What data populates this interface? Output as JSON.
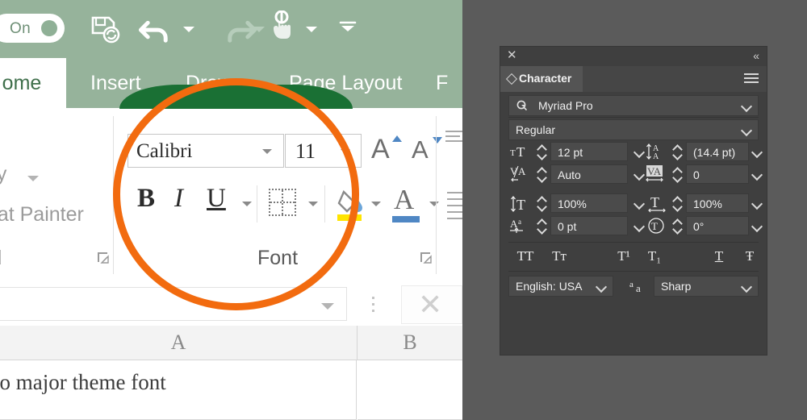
{
  "excel": {
    "quick_access": {
      "autosave_label": "On",
      "icons": [
        "save-sync-icon",
        "undo-icon",
        "undo-dropdown-icon",
        "redo-icon",
        "redo-dropdown-icon",
        "touch-mode-icon",
        "touch-mode-dropdown-icon",
        "customize-toolbar-icon"
      ]
    },
    "tabs": [
      {
        "id": "home",
        "label": "ome",
        "active": true
      },
      {
        "id": "insert",
        "label": "Insert",
        "active": false
      },
      {
        "id": "draw",
        "label": "Draw",
        "active": false
      },
      {
        "id": "pagelayout",
        "label": "Page Layout",
        "active": false
      },
      {
        "id": "formulas",
        "label": "F",
        "active": false
      }
    ],
    "clipboard_group": {
      "copy_label": "py",
      "format_painter_label": "mat Painter",
      "group_label": "rd"
    },
    "font_group": {
      "font_name": "Calibri",
      "font_size": "11",
      "grow_font_label": "A",
      "shrink_font_label": "A",
      "bold_label": "B",
      "italic_label": "I",
      "underline_label": "U",
      "group_label": "Font",
      "highlight_color": "#ffe400",
      "font_color": "#4f87c4"
    },
    "formula_bar": {
      "value": "",
      "close_label": "✕"
    },
    "sheet": {
      "columns": [
        "A",
        "B"
      ],
      "cells": [
        "to major theme font",
        ""
      ]
    },
    "magnifier": {
      "ring_color": "#f26b0f",
      "highlight_color": "#1a7034"
    },
    "theme": {
      "ribbon_green": "#96b39b",
      "active_tab_text": "#3f6f4b"
    }
  },
  "character_panel": {
    "close_label": "✕",
    "collapse_label": "«",
    "tab_label": "Character",
    "menu_icon": "hamburger-menu-icon",
    "font_family": {
      "value": "Myriad Pro",
      "icon": "search-font-icon"
    },
    "font_style": {
      "value": "Regular"
    },
    "fields": [
      {
        "name": "font-size",
        "icon": "font-size-icon",
        "value": "12 pt"
      },
      {
        "name": "leading",
        "icon": "leading-icon",
        "value": "(14.4 pt)"
      },
      {
        "name": "kerning",
        "icon": "kerning-icon",
        "value": "Auto"
      },
      {
        "name": "tracking",
        "icon": "tracking-icon",
        "value": "0"
      },
      {
        "name": "vertical-scale",
        "icon": "vertical-scale-icon",
        "value": "100%"
      },
      {
        "name": "horizontal-scale",
        "icon": "horizontal-scale-icon",
        "value": "100%"
      },
      {
        "name": "baseline-shift",
        "icon": "baseline-shift-icon",
        "value": "0 pt"
      },
      {
        "name": "character-rotation",
        "icon": "character-rotation-icon",
        "value": "0°"
      }
    ],
    "style_buttons": [
      {
        "name": "all-caps",
        "label": "TT"
      },
      {
        "name": "small-caps",
        "label": "Tт"
      },
      {
        "name": "superscript",
        "label": "T¹"
      },
      {
        "name": "subscript",
        "label": "T₁"
      },
      {
        "name": "underline",
        "label": "T"
      },
      {
        "name": "strikethrough",
        "label": "Ŧ"
      }
    ],
    "language": "English: USA",
    "antialias_icon": "anti-aliasing-icon",
    "antialias": "Sharp"
  }
}
